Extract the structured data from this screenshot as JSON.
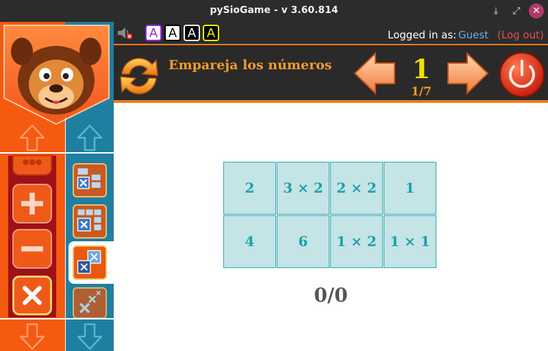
{
  "window": {
    "title": "pySioGame - v 3.60.814",
    "min_icon": "download-arrow-icon",
    "max_icon": "expand-icon",
    "close_icon": "close-icon"
  },
  "infobar": {
    "sound_icon": "sound-muted-icon",
    "font_buttons": [
      "A",
      "A",
      "A",
      "A"
    ],
    "logged_in_label": "Logged in as:",
    "user": "Guest",
    "logout": "(Log out)"
  },
  "game": {
    "title": "Empareja los números",
    "level": "1",
    "level_progress": "1/7"
  },
  "board": {
    "cells": [
      "2",
      "3 × 2",
      "2 × 2",
      "1",
      "4",
      "6",
      "1 × 2",
      "1 × 1"
    ]
  },
  "score": "0/0",
  "colors": {
    "sidebar_orange": "#f45a10",
    "sidebar_teal": "#1f7fa0",
    "cell_bg": "#c4e4e6",
    "cell_text": "#1aa0a8",
    "title_orange": "#f59a2b",
    "level_yellow": "#f2e000"
  }
}
